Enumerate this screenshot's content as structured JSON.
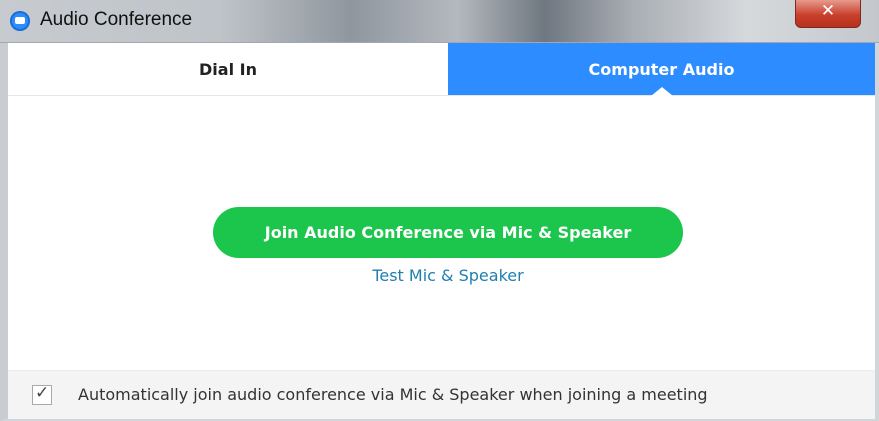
{
  "window": {
    "title": "Audio Conference",
    "app_icon": "zoom-logo-icon",
    "close_icon": "close-icon",
    "close_glyph": "✕"
  },
  "tabs": [
    {
      "label": "Dial In",
      "selected": false
    },
    {
      "label": "Computer Audio",
      "selected": true
    }
  ],
  "main": {
    "join_button_label": "Join Audio Conference via Mic & Speaker",
    "test_link_label": "Test Mic & Speaker"
  },
  "footer": {
    "auto_join_checked": true,
    "check_glyph": "✓",
    "auto_join_label": "Automatically join audio conference via Mic & Speaker when joining a meeting"
  },
  "colors": {
    "accent_blue": "#2d8cff",
    "join_green": "#1cc64d",
    "link_blue": "#1f7fb0",
    "close_red": "#c8412c"
  }
}
